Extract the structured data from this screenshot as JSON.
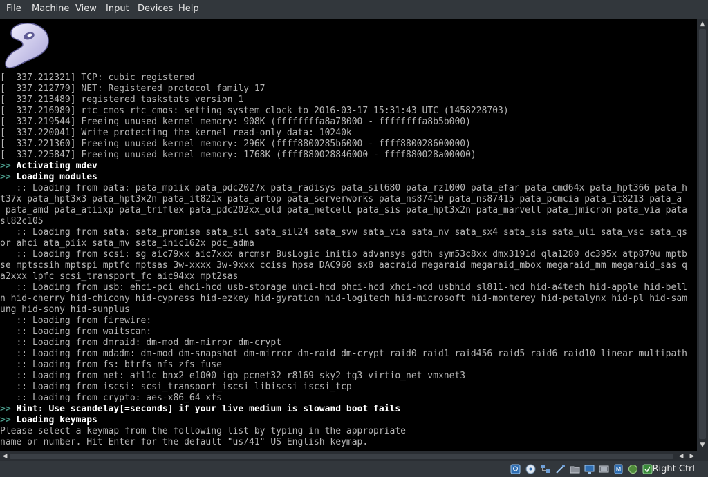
{
  "menu": [
    {
      "label": "File"
    },
    {
      "label": "Machine"
    },
    {
      "label": "View"
    },
    {
      "label": "Input"
    },
    {
      "label": "Devices"
    },
    {
      "label": "Help"
    }
  ],
  "console": {
    "lines": [
      {
        "text": "[  337.212321] TCP: cubic registered",
        "kind": "log"
      },
      {
        "text": "[  337.212779] NET: Registered protocol family 17",
        "kind": "log"
      },
      {
        "text": "[  337.213489] registered taskstats version 1",
        "kind": "log"
      },
      {
        "text": "[  337.216989] rtc_cmos rtc_cmos: setting system clock to 2016-03-17 15:31:43 UTC (1458228703)",
        "kind": "log"
      },
      {
        "text": "[  337.219544] Freeing unused kernel memory: 908K (ffffffffa8a78000 - ffffffffa8b5b000)",
        "kind": "log"
      },
      {
        "text": "[  337.220041] Write protecting the kernel read-only data: 10240k",
        "kind": "log"
      },
      {
        "text": "[  337.221360] Freeing unused kernel memory: 296K (ffff8800285b6000 - ffff880028600000)",
        "kind": "log"
      },
      {
        "text": "[  337.225847] Freeing unused kernel memory: 1768K (ffff880028846000 - ffff880028a00000)",
        "kind": "log"
      },
      {
        "text": ">> Activating mdev",
        "kind": "step"
      },
      {
        "text": ">> Loading modules",
        "kind": "step"
      },
      {
        "text": "   :: Loading from pata: pata_mpiix pata_pdc2027x pata_radisys pata_sil680 pata_rz1000 pata_efar pata_cmd64x pata_hpt366 pata_h",
        "kind": "log"
      },
      {
        "text": "t37x pata_hpt3x3 pata_hpt3x2n pata_it821x pata_artop pata_serverworks pata_ns87410 pata_ns87415 pata_pcmcia pata_it8213 pata_a",
        "kind": "log"
      },
      {
        "text": " pata_amd pata_atiixp pata_triflex pata_pdc202xx_old pata_netcell pata_sis pata_hpt3x2n pata_marvell pata_jmicron pata_via pata",
        "kind": "log"
      },
      {
        "text": "sl82c105",
        "kind": "log"
      },
      {
        "text": "   :: Loading from sata: sata_promise sata_sil sata_sil24 sata_svw sata_via sata_nv sata_sx4 sata_sis sata_uli sata_vsc sata_qs",
        "kind": "log"
      },
      {
        "text": "or ahci ata_piix sata_mv sata_inic162x pdc_adma",
        "kind": "log"
      },
      {
        "text": "   :: Loading from scsi: sg aic79xx aic7xxx arcmsr BusLogic initio advansys gdth sym53c8xx dmx3191d qla1280 dc395x atp870u mptb",
        "kind": "log"
      },
      {
        "text": "se mptscsih mptspi mptfc mptsas 3w-xxxx 3w-9xxx cciss hpsa DAC960 sx8 aacraid megaraid megaraid_mbox megaraid_mm megaraid_sas q",
        "kind": "log"
      },
      {
        "text": "a2xxx lpfc scsi_transport_fc aic94xx mpt2sas",
        "kind": "log"
      },
      {
        "text": "   :: Loading from usb: ehci-pci ehci-hcd usb-storage uhci-hcd ohci-hcd xhci-hcd usbhid sl811-hcd hid-a4tech hid-apple hid-bell",
        "kind": "log"
      },
      {
        "text": "n hid-cherry hid-chicony hid-cypress hid-ezkey hid-gyration hid-logitech hid-microsoft hid-monterey hid-petalynx hid-pl hid-sam",
        "kind": "log"
      },
      {
        "text": "ung hid-sony hid-sunplus",
        "kind": "log"
      },
      {
        "text": "   :: Loading from firewire:",
        "kind": "log"
      },
      {
        "text": "   :: Loading from waitscan:",
        "kind": "log"
      },
      {
        "text": "   :: Loading from dmraid: dm-mod dm-mirror dm-crypt",
        "kind": "log"
      },
      {
        "text": "   :: Loading from mdadm: dm-mod dm-snapshot dm-mirror dm-raid dm-crypt raid0 raid1 raid456 raid5 raid6 raid10 linear multipath",
        "kind": "log"
      },
      {
        "text": "   :: Loading from fs: btrfs nfs zfs fuse",
        "kind": "log"
      },
      {
        "text": "   :: Loading from net: atl1c bnx2 e1000 igb pcnet32 r8169 sky2 tg3 virtio_net vmxnet3",
        "kind": "log"
      },
      {
        "text": "   :: Loading from iscsi: scsi_transport_iscsi libiscsi iscsi_tcp",
        "kind": "log"
      },
      {
        "text": "   :: Loading from crypto: aes-x86_64 xts",
        "kind": "log"
      },
      {
        "text": ">> Hint: Use scandelay[=seconds] if your live medium is slowand boot fails",
        "kind": "step"
      },
      {
        "text": ">> Loading keymaps",
        "kind": "step"
      },
      {
        "text": "Please select a keymap from the following list by typing in the appropriate",
        "kind": "log"
      },
      {
        "text": "name or number. Hit Enter for the default \"us/41\" US English keymap.",
        "kind": "log"
      }
    ]
  },
  "statusbar": {
    "icons": [
      "hard-disk-icon",
      "optical-drive-icon",
      "network-icon",
      "usb-icon",
      "shared-folders-icon",
      "display-icon",
      "video-capture-icon",
      "mouse-integration-icon",
      "cpu-icon",
      "keyboard-capture-icon"
    ],
    "host_key": "Right Ctrl"
  }
}
